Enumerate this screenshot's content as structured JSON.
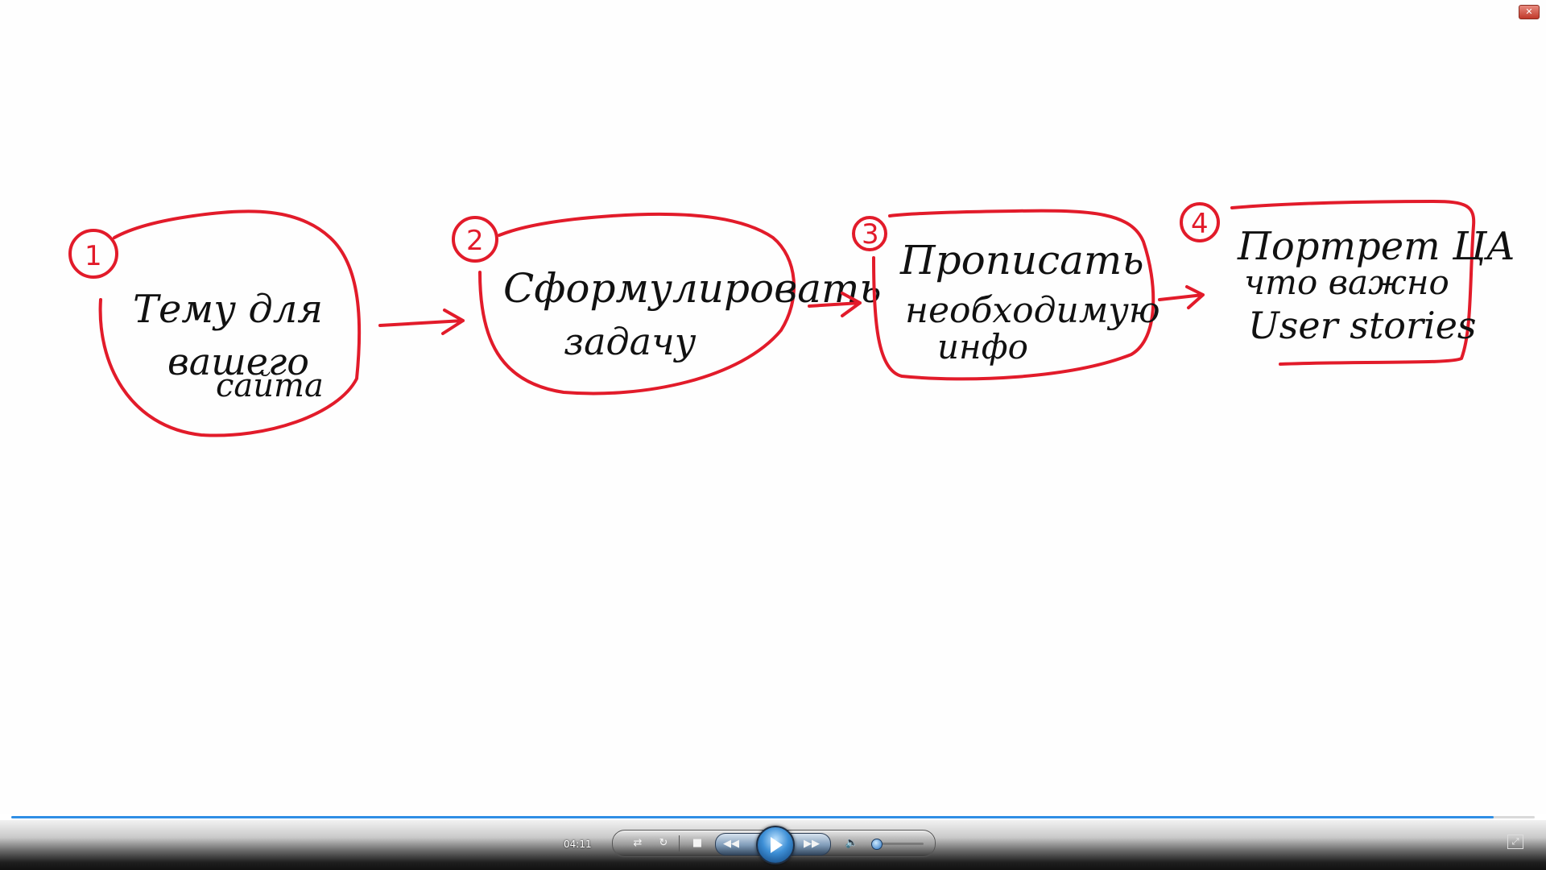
{
  "window": {
    "close_label": "✕"
  },
  "whiteboard": {
    "steps": [
      {
        "number": "1",
        "lines": [
          "Тему для",
          "вашего",
          "сайта"
        ]
      },
      {
        "number": "2",
        "lines": [
          "Сформулировать",
          "задачу"
        ]
      },
      {
        "number": "3",
        "lines": [
          "Прописать",
          "необходимую",
          "инфо"
        ]
      },
      {
        "number": "4",
        "lines": [
          "Портрет ЦА",
          "что важно",
          "User stories"
        ]
      }
    ],
    "ink_color": "#e21b2a"
  },
  "player": {
    "elapsed_time": "04:11",
    "progress_fraction": 0.973,
    "volume_fraction": 0.08,
    "icons": {
      "shuffle": "shuffle-icon",
      "repeat": "repeat-icon",
      "stop": "stop-icon",
      "previous": "rewind-icon",
      "play": "play-icon",
      "next": "fast-forward-icon",
      "mute": "speaker-icon",
      "switch_view": "switch-to-library-icon"
    },
    "accent_color": "#2f8ee5"
  }
}
